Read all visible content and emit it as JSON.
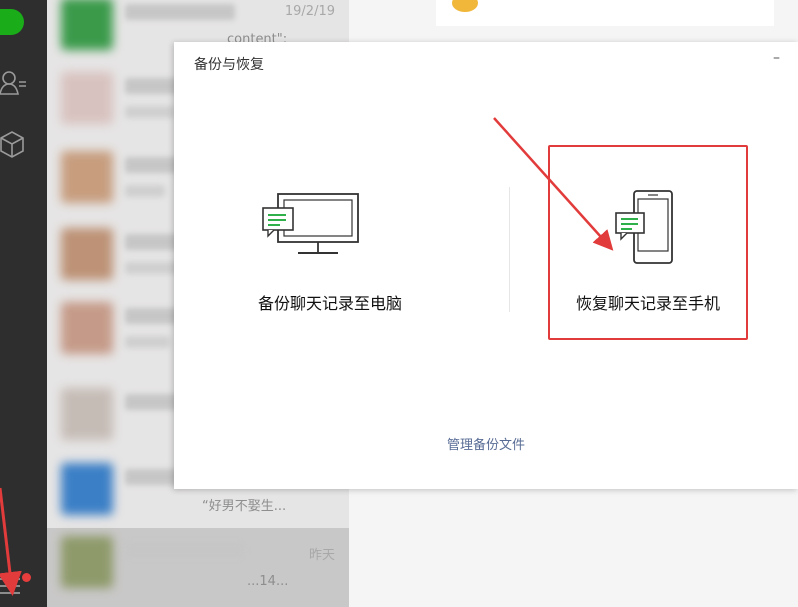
{
  "chat_list": {
    "items": [
      {
        "time": "19/2/19",
        "preview": "content\":"
      },
      {
        "time": "",
        "preview": ""
      },
      {
        "time": "",
        "preview": ""
      },
      {
        "time": "",
        "preview": ""
      },
      {
        "time": "",
        "preview": ""
      },
      {
        "time": "",
        "preview": ""
      },
      {
        "time": "",
        "preview": "“好男不娶生..."
      },
      {
        "time": "昨天",
        "preview": "...14..."
      }
    ]
  },
  "dialog": {
    "title": "备份与恢复",
    "minimize": "–",
    "backup_to_pc_label": "备份聊天记录至电脑",
    "restore_to_phone_label": "恢复聊天记录至手机",
    "manage_backup_link": "管理备份文件"
  },
  "colors": {
    "sidebar": "#2e2e2e",
    "chat_list_bg": "#e6e5e5",
    "accent_green": "#1aad19",
    "highlight_red": "#e23b3b",
    "link_blue": "#576b95"
  },
  "icons": {
    "rail": [
      "chat-icon",
      "contacts-icon",
      "collections-box-icon",
      "menu-icon"
    ],
    "dialog": [
      "computer-chat-icon",
      "phone-chat-icon"
    ]
  }
}
